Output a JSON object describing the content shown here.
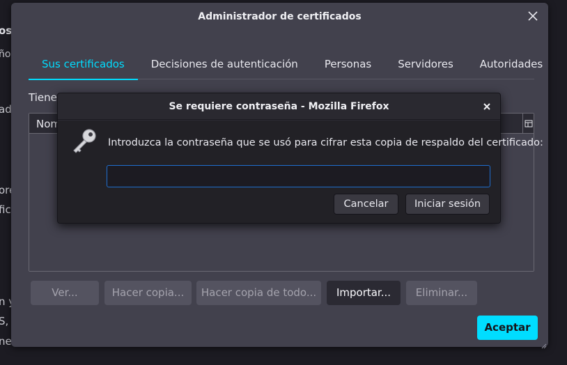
{
  "background_fragments": [
    "os",
    "ños",
    "ado",
    "ore",
    "fic",
    "n y",
    "S,",
    "ne"
  ],
  "window": {
    "title": "Administrador de certificados",
    "tabs": [
      {
        "label": "Sus certificados",
        "active": true
      },
      {
        "label": "Decisiones de autenticación",
        "active": false
      },
      {
        "label": "Personas",
        "active": false
      },
      {
        "label": "Servidores",
        "active": false
      },
      {
        "label": "Autoridades",
        "active": false
      }
    ],
    "description_fragment": "Tiene",
    "table": {
      "first_column_fragment": "Nom"
    },
    "buttons": [
      {
        "label": "Ver...",
        "enabled": false
      },
      {
        "label": "Hacer copia...",
        "enabled": false
      },
      {
        "label": "Hacer copia de todo...",
        "enabled": false
      },
      {
        "label": "Importar...",
        "enabled": true
      },
      {
        "label": "Eliminar...",
        "enabled": false
      }
    ],
    "accept_label": "Aceptar"
  },
  "dialog": {
    "title": "Se requiere contraseña - Mozilla Firefox",
    "message": "Introduzca la contraseña que se usó para cifrar esta copia de respaldo del certificado:",
    "password_value": "",
    "cancel_label": "Cancelar",
    "login_label": "Iniciar sesión"
  },
  "colors": {
    "accent": "#00ddff",
    "window_bg": "#42414d",
    "dialog_bg": "#222126",
    "input_focus": "#1f6fd1"
  }
}
